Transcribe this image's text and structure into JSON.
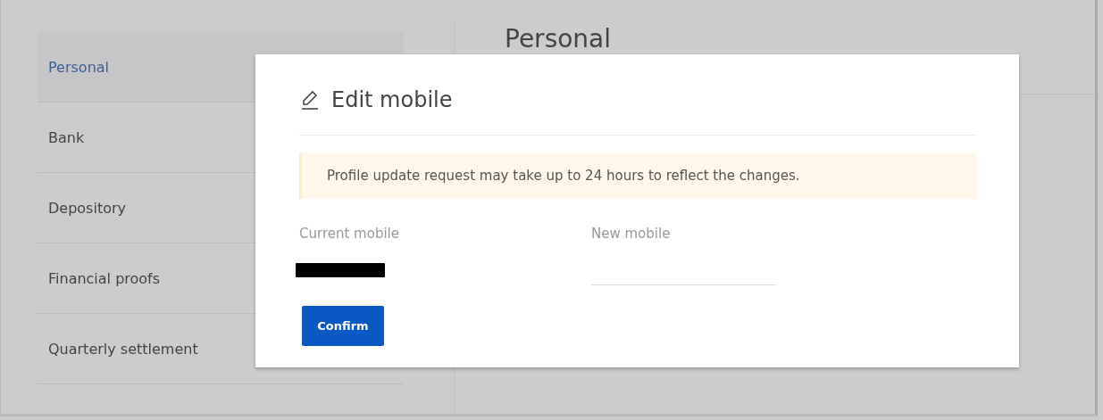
{
  "sidebar": {
    "items": [
      {
        "label": "Personal",
        "selected": true
      },
      {
        "label": "Bank",
        "selected": false
      },
      {
        "label": "Depository",
        "selected": false
      },
      {
        "label": "Financial proofs",
        "selected": false
      },
      {
        "label": "Quarterly settlement",
        "selected": false
      }
    ]
  },
  "content": {
    "title": "Personal"
  },
  "modal": {
    "title": "Edit mobile",
    "notice": "Profile update request may take up to 24 hours to reflect the changes.",
    "current_mobile": {
      "label": "Current mobile",
      "redacted": true
    },
    "new_mobile": {
      "label": "New mobile"
    },
    "button": "Confirm"
  }
}
